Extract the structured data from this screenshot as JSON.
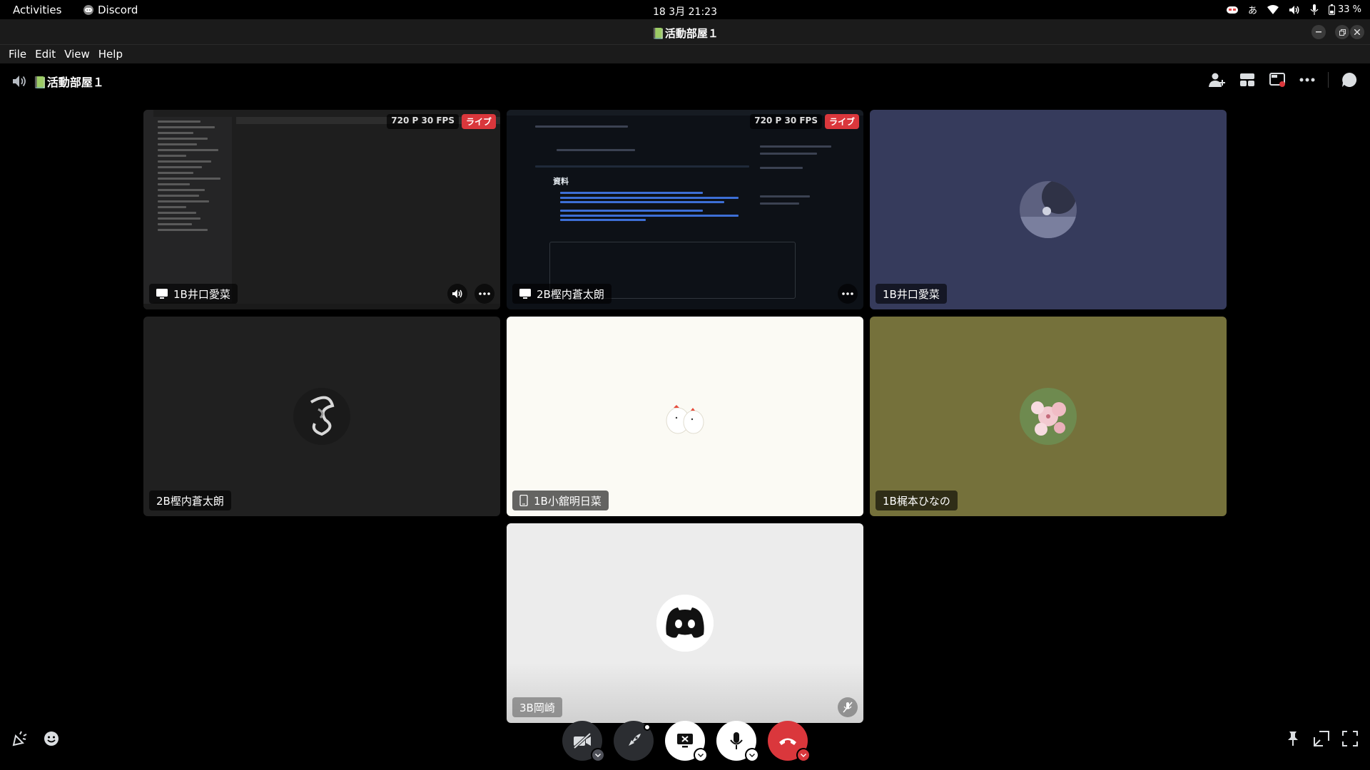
{
  "topbar": {
    "activities": "Activities",
    "app_name": "Discord",
    "clock": "18 3月  21:23",
    "ime": "あ",
    "battery": "33 %"
  },
  "window": {
    "title": "📗活動部屋１",
    "menu": [
      "File",
      "Edit",
      "View",
      "Help"
    ]
  },
  "channel": {
    "name": "📗活動部屋１"
  },
  "tiles": {
    "t1": {
      "name": "1B井口愛菜",
      "quality": "720 P 30 FPS",
      "live": "ライブ"
    },
    "t2": {
      "name": "2B樫内蒼太朗",
      "quality": "720 P 30 FPS",
      "live": "ライブ"
    },
    "t3": {
      "name": "1B井口愛菜",
      "bg": "#363b5c"
    },
    "t4": {
      "name": "2B樫内蒼太朗",
      "bg": "#202020"
    },
    "t5": {
      "name": "1B小舘明日菜",
      "bg": "#fbfaf4"
    },
    "t6": {
      "name": "1B梶本ひなの",
      "bg": "#75713b"
    },
    "t7": {
      "name": "3B岡崎",
      "bg": "#ececec"
    }
  },
  "share_text": {
    "heading": "資料"
  },
  "colors": {
    "hangup": "#da373c",
    "live": "#da373c",
    "control_dark": "#2b2d31",
    "control_light": "#ffffff"
  },
  "icons": [
    "speaker-icon",
    "add-member-icon",
    "grid-layout-icon",
    "popout-icon",
    "more-icon",
    "chat-icon",
    "camera-off-icon",
    "activities-icon",
    "screen-share-stop-icon",
    "microphone-icon",
    "hangup-icon",
    "soundboard-icon",
    "emoji-icon",
    "pin-icon",
    "minimize-view-icon",
    "fullscreen-icon"
  ]
}
